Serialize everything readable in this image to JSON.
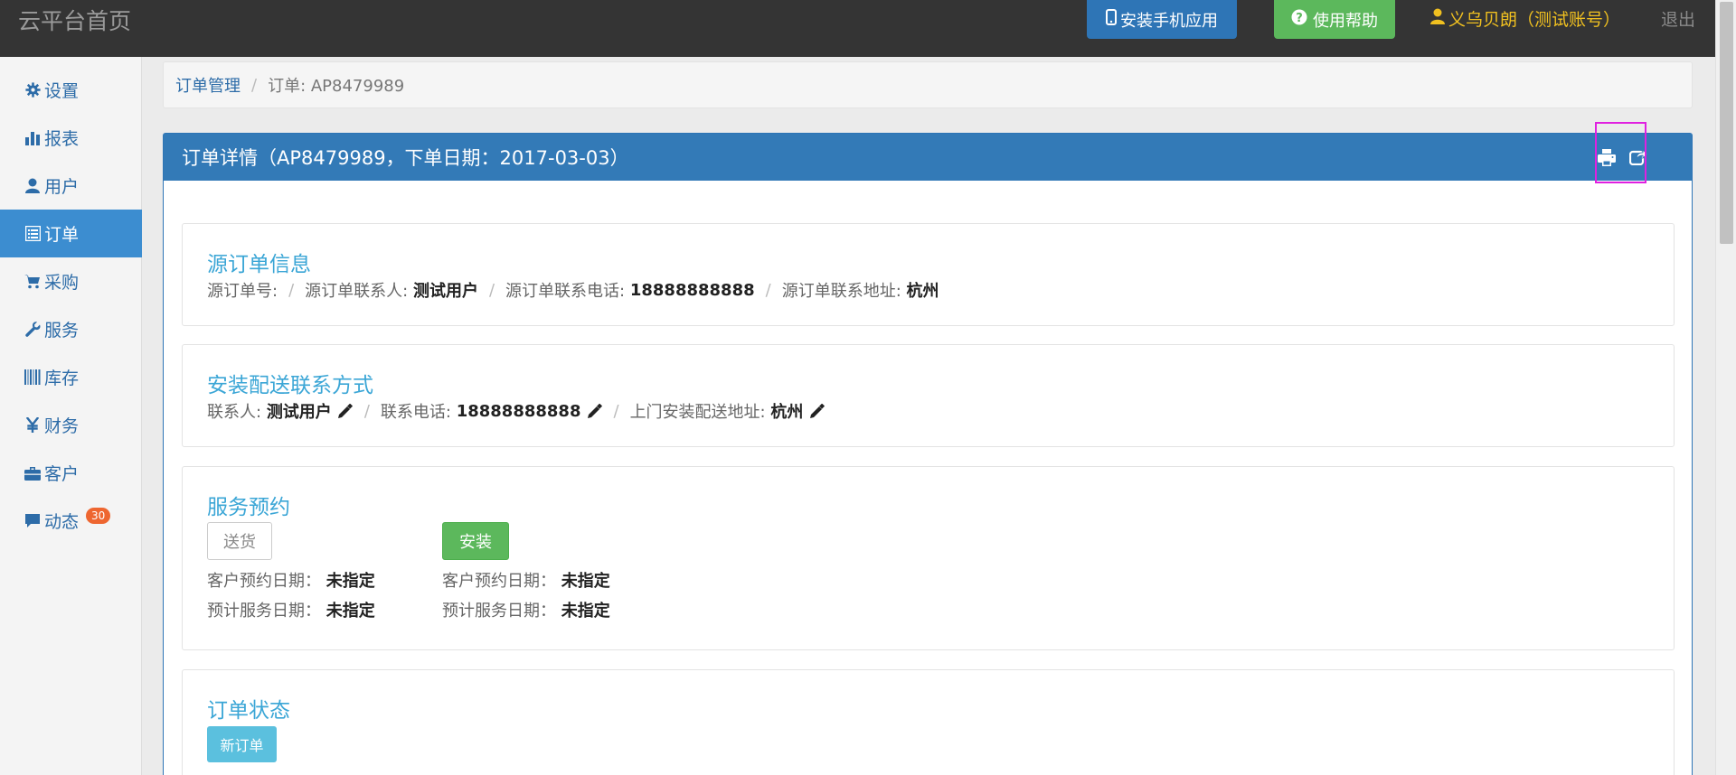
{
  "header": {
    "brand": "云平台首页",
    "install_app": "安装手机应用",
    "help": "使用帮助",
    "user": "义乌贝朗（测试账号）",
    "logout": "退出"
  },
  "sidebar": {
    "items": [
      {
        "label": "设置",
        "icon": "gear-icon"
      },
      {
        "label": "报表",
        "icon": "bar-chart-icon"
      },
      {
        "label": "用户",
        "icon": "user-icon"
      },
      {
        "label": "订单",
        "icon": "list-icon",
        "active": true
      },
      {
        "label": "采购",
        "icon": "cart-icon"
      },
      {
        "label": "服务",
        "icon": "wrench-icon"
      },
      {
        "label": "库存",
        "icon": "barcode-icon"
      },
      {
        "label": "财务",
        "icon": "yen-icon"
      },
      {
        "label": "客户",
        "icon": "briefcase-icon"
      },
      {
        "label": "动态",
        "icon": "comment-icon",
        "badge": "30"
      }
    ]
  },
  "breadcrumb": {
    "parent": "订单管理",
    "separator": "/",
    "current": "订单: AP8479989"
  },
  "panel": {
    "title": "订单详情（AP8479989，下单日期：2017-03-03）"
  },
  "source_order": {
    "title": "源订单信息",
    "order_no_label": "源订单号:",
    "contact_label": "源订单联系人:",
    "contact_value": "测试用户",
    "phone_label": "源订单联系电话:",
    "phone_value": "18888888888",
    "address_label": "源订单联系地址:",
    "address_value": "杭州"
  },
  "delivery_contact": {
    "title": "安装配送联系方式",
    "contact_label": "联系人:",
    "contact_value": "测试用户",
    "phone_label": "联系电话:",
    "phone_value": "18888888888",
    "address_label": "上门安装配送地址:",
    "address_value": "杭州"
  },
  "service": {
    "title": "服务预约",
    "delivery_btn": "送货",
    "install_btn": "安装",
    "customer_date_label": "客户预约日期：",
    "expected_date_label": "预计服务日期：",
    "unspecified": "未指定"
  },
  "order_status": {
    "title": "订单状态",
    "status": "新订单"
  }
}
